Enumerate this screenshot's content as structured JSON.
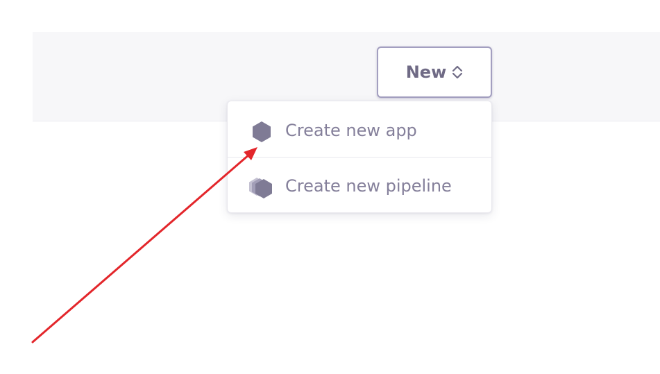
{
  "header": {
    "new_button": {
      "label": "New",
      "icon": "chevron-up-down-icon"
    }
  },
  "dropdown": {
    "items": [
      {
        "label": "Create new app",
        "icon": "hexagon-icon"
      },
      {
        "label": "Create new pipeline",
        "icon": "stacked-hexagons-icon"
      }
    ]
  },
  "colors": {
    "text": "#847f9a",
    "button_text": "#6f6a85",
    "button_border": "#a39fc0",
    "icon_fill": "#7f7b95",
    "header_background": "#f7f7f9",
    "annotation_arrow": "#e3262b"
  },
  "annotation": {
    "type": "arrow",
    "points_to": "hexagon-icon"
  }
}
